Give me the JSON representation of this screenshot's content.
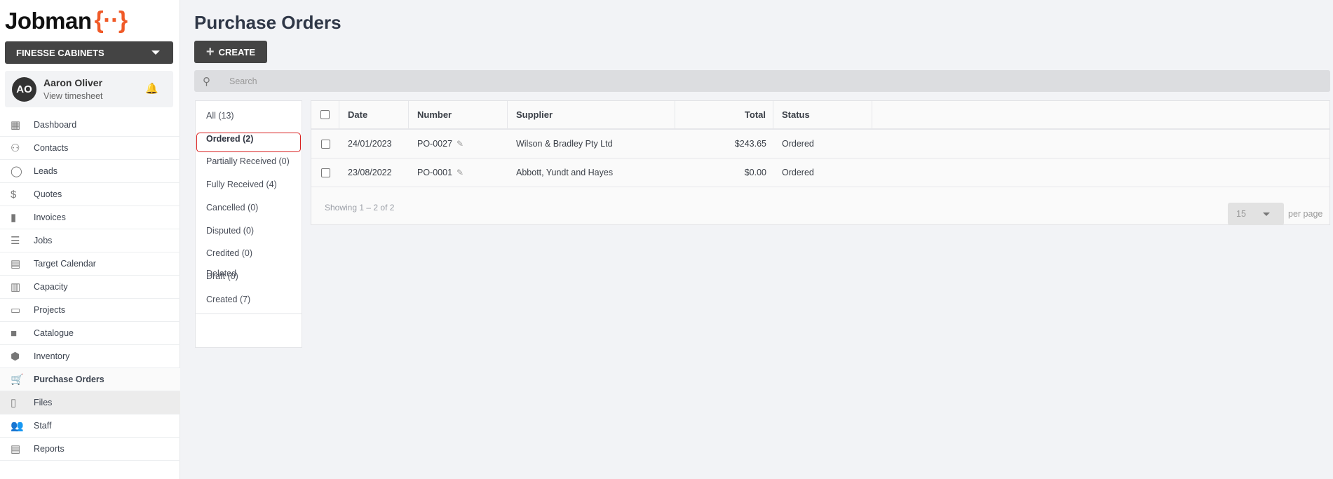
{
  "brand": {
    "name": "Jobman",
    "mark": "{··}",
    "accent": "#f05a28"
  },
  "company": "FINESSE CABINETS",
  "user": {
    "initials": "AO",
    "name": "Aaron Oliver",
    "link": "View timesheet"
  },
  "nav": [
    {
      "label": "Dashboard",
      "icon": "▦"
    },
    {
      "label": "Contacts",
      "icon": "⚇"
    },
    {
      "label": "Leads",
      "icon": "◯"
    },
    {
      "label": "Quotes",
      "icon": "$"
    },
    {
      "label": "Invoices",
      "icon": "▮"
    },
    {
      "label": "Jobs",
      "icon": "☰"
    },
    {
      "label": "Target Calendar",
      "icon": "▤"
    },
    {
      "label": "Capacity",
      "icon": "▥"
    },
    {
      "label": "Projects",
      "icon": "▭"
    },
    {
      "label": "Catalogue",
      "icon": "■"
    },
    {
      "label": "Inventory",
      "icon": "⬢"
    },
    {
      "label": "Purchase Orders",
      "icon": "🛒"
    },
    {
      "label": "Files",
      "icon": "▯"
    },
    {
      "label": "Staff",
      "icon": "👥"
    },
    {
      "label": "Reports",
      "icon": "▤"
    }
  ],
  "page": {
    "title": "Purchase Orders",
    "create": "CREATE",
    "search_placeholder": "Search"
  },
  "filters": [
    "All (13)",
    "Ordered (2)",
    "Partially Received (0)",
    "Fully Received (4)",
    "Cancelled (0)",
    "Disputed (0)",
    "Credited (0)",
    "Draft (0)",
    "Created (7)"
  ],
  "deleted": "Deleted",
  "table": {
    "headers": [
      "Date",
      "Number",
      "Supplier",
      "Total",
      "Status"
    ],
    "rows": [
      {
        "date": "24/01/2023",
        "number": "PO-0027",
        "supplier": "Wilson & Bradley Pty Ltd",
        "total": "$243.65",
        "status": "Ordered"
      },
      {
        "date": "23/08/2022",
        "number": "PO-0001",
        "supplier": "Abbott, Yundt and Hayes",
        "total": "$0.00",
        "status": "Ordered"
      }
    ],
    "showing": "Showing 1 – 2 of 2",
    "per_page": "15",
    "per_page_label": "per page"
  }
}
